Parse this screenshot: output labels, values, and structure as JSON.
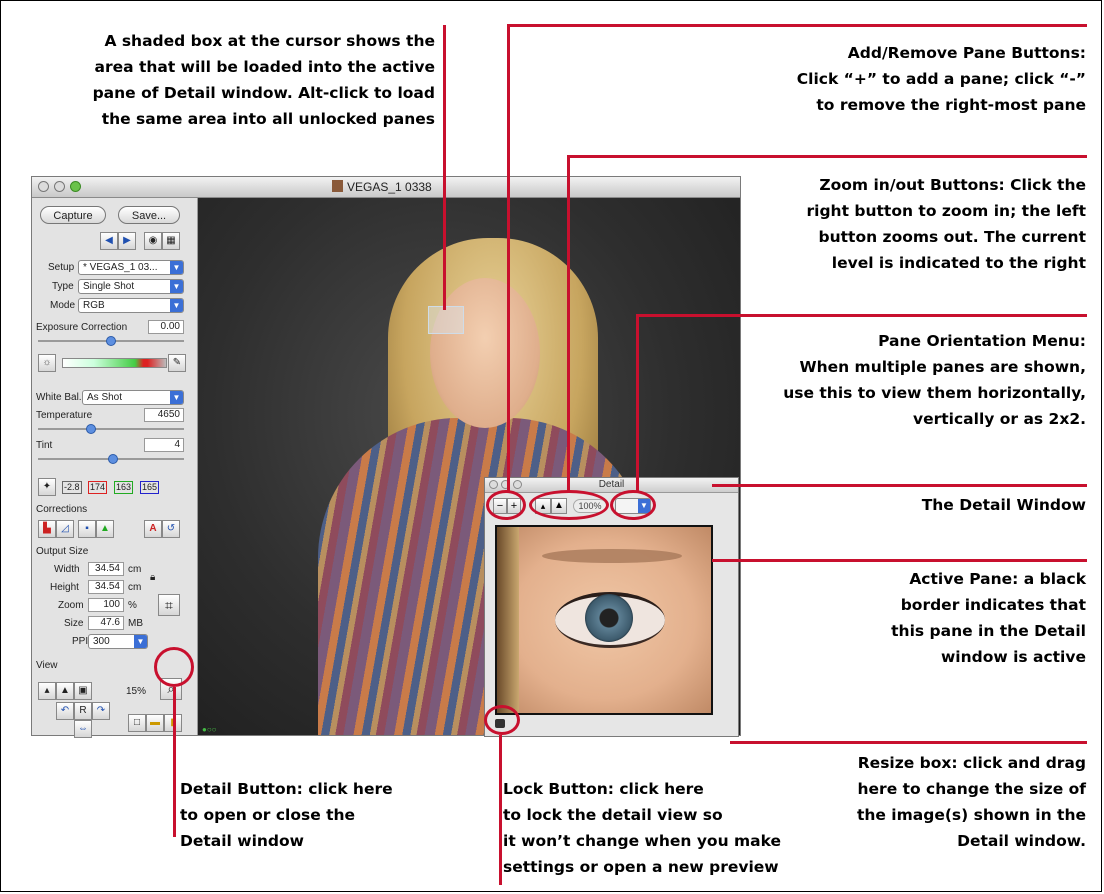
{
  "callouts": {
    "shaded_box": [
      "A shaded box at the cursor shows the",
      "area that will be loaded into the active",
      "pane of Detail window.  Alt-click to load",
      "the same area into all unlocked panes"
    ],
    "add_remove": [
      "Add/Remove Pane Buttons:",
      "Click “+” to add a pane; click “-”",
      "to remove the right-most pane"
    ],
    "zoom": [
      "Zoom in/out Buttons: Click the",
      "right button to zoom in; the left",
      "button zooms out. The  current",
      "level is indicated to the right"
    ],
    "orientation": [
      "Pane Orientation Menu:",
      "When multiple panes are shown,",
      "use this to view them horizontally,",
      "vertically or as 2x2."
    ],
    "detail_window": [
      "The  Detail Window"
    ],
    "active_pane": [
      "Active Pane: a black",
      "border indicates that",
      "this pane in the Detail",
      "window is active"
    ],
    "resize": [
      "Resize box: click and drag",
      "here to change the size of",
      "the image(s) shown in the",
      "Detail window."
    ],
    "detail_button": [
      "Detail Button: click here",
      "to open or close the",
      "Detail window"
    ],
    "lock_button": [
      "Lock Button: click here",
      "to lock the detail view so",
      "it won’t change when you make",
      "settings or open a new preview"
    ]
  },
  "window": {
    "title": "VEGAS_1  0338"
  },
  "sidebar": {
    "capture_label": "Capture",
    "save_label": "Save...",
    "setup_label": "Setup",
    "setup_value": "* VEGAS_1 03...",
    "type_label": "Type",
    "type_value": "Single Shot",
    "mode_label": "Mode",
    "mode_value": "RGB",
    "exposure_label": "Exposure Correction",
    "exposure_value": "0.00",
    "whitebal_label": "White Bal.",
    "whitebal_value": "As Shot",
    "temperature_label": "Temperature",
    "temperature_value": "4650",
    "tint_label": "Tint",
    "tint_value": "4",
    "readout": {
      "v1": "-2.8",
      "r": "174",
      "g": "163",
      "b": "165"
    },
    "corrections_label": "Corrections",
    "output_size_label": "Output Size",
    "width_label": "Width",
    "width_value": "34.54",
    "width_unit": "cm",
    "height_label": "Height",
    "height_value": "34.54",
    "height_unit": "cm",
    "zoom_label": "Zoom",
    "zoom_value": "100",
    "zoom_unit": "%",
    "size_label": "Size",
    "size_value": "47.6",
    "size_unit": "MB",
    "ppi_label": "PPI",
    "ppi_value": "300",
    "view_label": "View",
    "view_zoom": "15%",
    "rotate_r": "R"
  },
  "detail": {
    "title": "Detail",
    "minus_label": "−",
    "plus_label": "+",
    "zoom_level": "100%"
  },
  "colors": {
    "callout_red": "#c8102e",
    "accent_blue": "#3b6fd6"
  }
}
